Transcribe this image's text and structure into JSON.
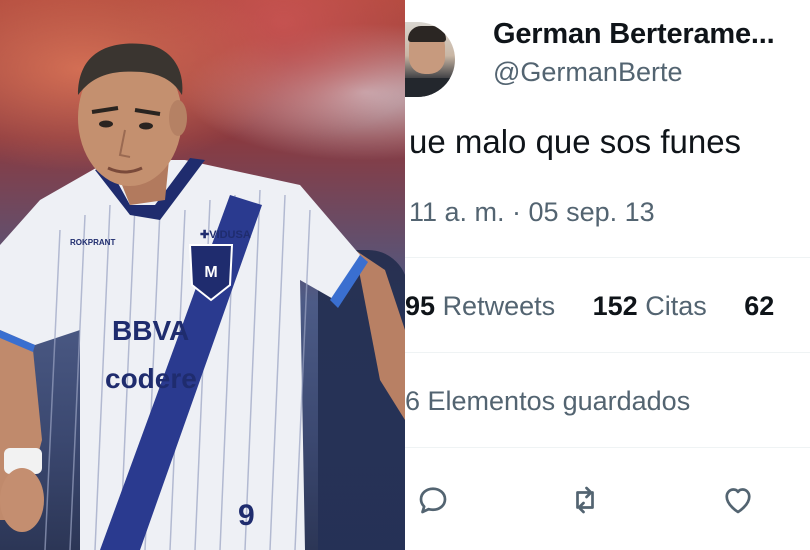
{
  "tweet": {
    "name": "German Berterame...",
    "handle": "@GermanBerte",
    "text": "ue malo que sos funes",
    "meta": "11 a. m. · 05 sep. 13",
    "stats": {
      "retweets_count": "95",
      "retweets_label": "Retweets",
      "quotes_count": "152",
      "quotes_label": "Citas",
      "likes_count": "62"
    },
    "saved": "6 Elementos guardados"
  },
  "icons": {
    "reply": "reply-icon",
    "retweet": "retweet-icon",
    "like": "like-icon"
  },
  "colors": {
    "secondary_text": "#536471",
    "primary_text": "#0f1419",
    "divider": "#eff3f4",
    "jersey_stripe": "#2a3a8f"
  }
}
